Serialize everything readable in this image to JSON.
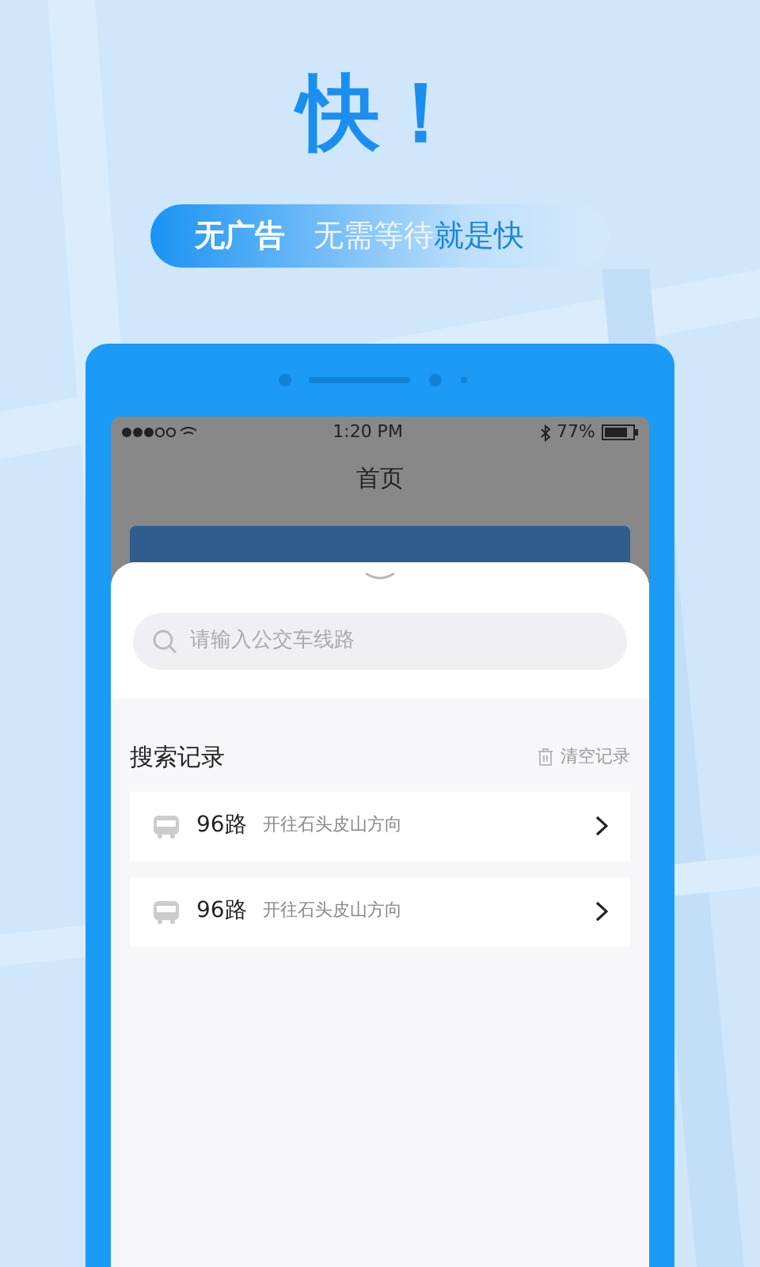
{
  "headline": "快！",
  "tagline": {
    "tag": "无广告",
    "text_plain": "无需等待",
    "text_emphasis": "就是快"
  },
  "status_bar": {
    "time": "1:20 PM",
    "battery": "77%"
  },
  "screen_title": "首页",
  "search": {
    "placeholder": "请输入公交车线路"
  },
  "history": {
    "title": "搜索记录",
    "clear": "清空记录",
    "items": [
      {
        "route": "96路",
        "direction": "开往石头皮山方向"
      },
      {
        "route": "96路",
        "direction": "开往石头皮山方向"
      }
    ]
  }
}
